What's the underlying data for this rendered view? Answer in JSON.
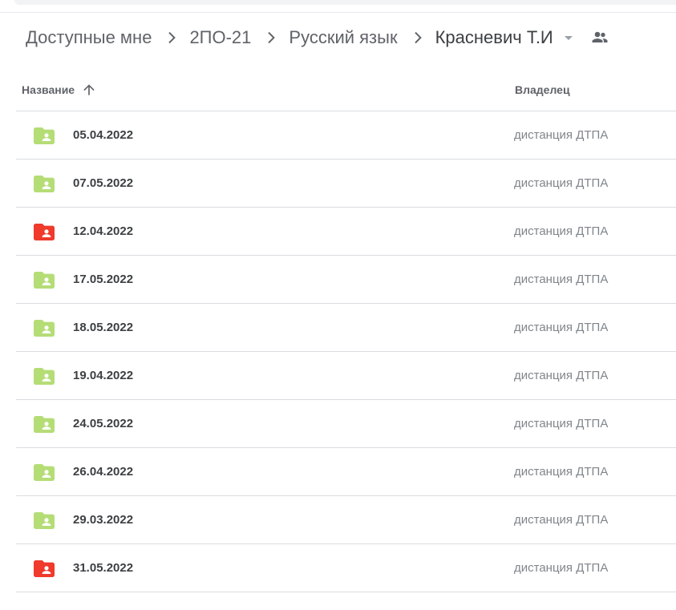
{
  "breadcrumb": {
    "items": [
      "Доступные мне",
      "2ПО-21",
      "Русский язык",
      "Красневич Т.И"
    ]
  },
  "columns": {
    "name": "Название",
    "owner": "Владелец"
  },
  "colors": {
    "folder_green": "#b5dd76",
    "folder_red": "#ef3a2c",
    "icon_gray": "#5f6368"
  },
  "files": [
    {
      "name": "05.04.2022",
      "owner": "дистанция ДТПА",
      "color": "#b5dd76"
    },
    {
      "name": "07.05.2022",
      "owner": "дистанция ДТПА",
      "color": "#b5dd76"
    },
    {
      "name": "12.04.2022",
      "owner": "дистанция ДТПА",
      "color": "#ef3a2c"
    },
    {
      "name": "17.05.2022",
      "owner": "дистанция ДТПА",
      "color": "#b5dd76"
    },
    {
      "name": "18.05.2022",
      "owner": "дистанция ДТПА",
      "color": "#b5dd76"
    },
    {
      "name": "19.04.2022",
      "owner": "дистанция ДТПА",
      "color": "#b5dd76"
    },
    {
      "name": "24.05.2022",
      "owner": "дистанция ДТПА",
      "color": "#b5dd76"
    },
    {
      "name": "26.04.2022",
      "owner": "дистанция ДТПА",
      "color": "#b5dd76"
    },
    {
      "name": "29.03.2022",
      "owner": "дистанция ДТПА",
      "color": "#b5dd76"
    },
    {
      "name": "31.05.2022",
      "owner": "дистанция ДТПА",
      "color": "#ef3a2c"
    }
  ]
}
